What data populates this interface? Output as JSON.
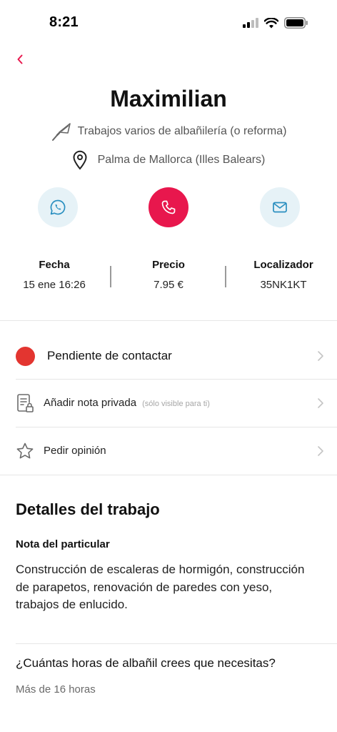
{
  "status_bar": {
    "time": "8:21"
  },
  "contact": {
    "name": "Maximilian",
    "service": "Trabajos varios de albañilería (o reforma)",
    "location": "Palma de Mallorca (Illes Balears)"
  },
  "actions": {
    "whatsapp_icon": "whatsapp-icon",
    "call_icon": "phone-icon",
    "email_icon": "mail-icon"
  },
  "stats": {
    "fecha": {
      "label": "Fecha",
      "value": "15 ene 16:26"
    },
    "precio": {
      "label": "Precio",
      "value": "7.95 €"
    },
    "localizador": {
      "label": "Localizador",
      "value": "35NK1KT"
    }
  },
  "rows": {
    "status": {
      "label": "Pendiente de contactar",
      "color": "#e33530"
    },
    "note": {
      "label": "Añadir nota privada",
      "hint": "(sólo visible para ti)"
    },
    "review": {
      "label": "Pedir opinión"
    }
  },
  "details": {
    "title": "Detalles del trabajo",
    "note_title": "Nota del particular",
    "note_body": "Construcción de escaleras de hormigón, construcción de parapetos, renovación de paredes con yeso, trabajos de enlucido.",
    "question": "¿Cuántas horas de albañil crees que necesitas?",
    "answer": "Más de 16 horas"
  },
  "colors": {
    "accent": "#e8174d",
    "action_bg": "#e6f2f7",
    "action_icon": "#2a8fc0"
  }
}
